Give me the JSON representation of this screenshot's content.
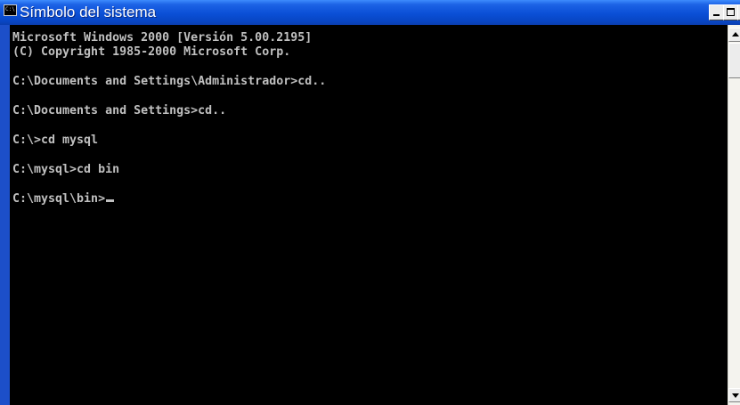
{
  "window": {
    "title": "Símbolo del sistema",
    "icon": "command-prompt-icon",
    "icon_glyph": "C:\\"
  },
  "controls": {
    "minimize_icon": "minimize-icon",
    "maximize_icon": "maximize-icon",
    "close_icon": "close-icon",
    "close_glyph": "×"
  },
  "console": {
    "background": "#000000",
    "text_color": "#c0c0c0",
    "lines": [
      "Microsoft Windows 2000 [Versión 5.00.2195]",
      "(C) Copyright 1985-2000 Microsoft Corp.",
      "",
      "C:\\Documents and Settings\\Administrador>cd..",
      "",
      "C:\\Documents and Settings>cd..",
      "",
      "C:\\>cd mysql",
      "",
      "C:\\mysql>cd bin",
      "",
      "C:\\mysql\\bin>"
    ]
  },
  "scrollbar": {
    "up_icon": "scroll-up-arrow-icon",
    "down_icon": "scroll-down-arrow-icon"
  },
  "colors": {
    "titlebar": "#0a4fd6",
    "frame": "#1c4fc9",
    "title_text": "#ffffff"
  }
}
